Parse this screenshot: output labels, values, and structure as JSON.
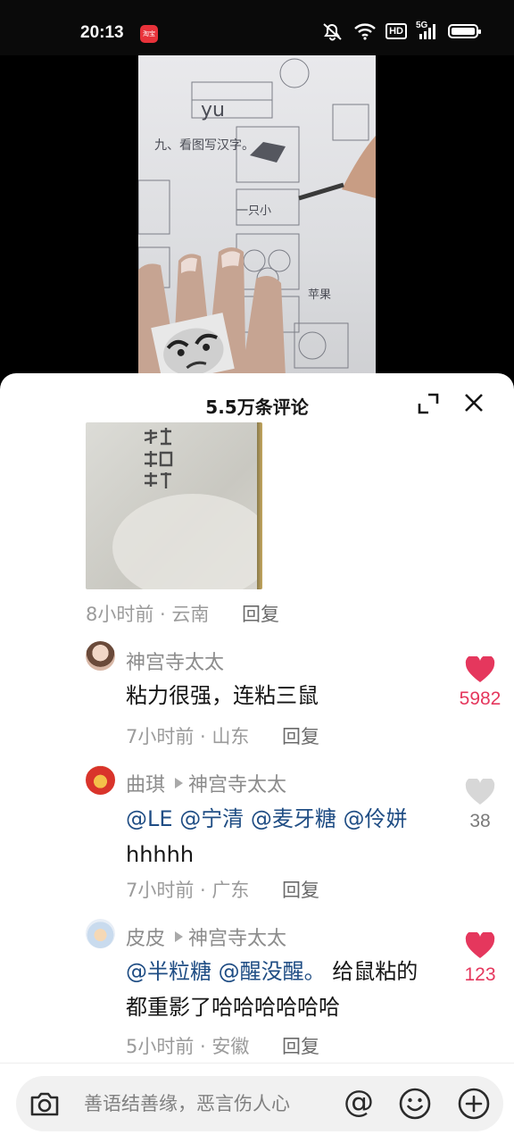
{
  "status_bar": {
    "time": "20:13",
    "app_badge": "淘宝",
    "icons": [
      "mute-icon",
      "wifi-icon",
      "hd-icon",
      "signal-5g-icon",
      "battery-icon"
    ],
    "hd_label": "HD",
    "network_label": "5G"
  },
  "video": {
    "description_icon": "video-frame"
  },
  "comments_sheet": {
    "title": "5.5万条评论",
    "expand_icon": "expand-icon",
    "close_icon": "close-icon"
  },
  "top_comment": {
    "time_location": "8小时前 · 云南",
    "reply_label": "回复"
  },
  "replies": [
    {
      "username": "神宫寺太太",
      "reply_to": "",
      "text_plain": "粘力很强，连粘三鼠",
      "time_location": "7小时前 · 山东",
      "reply_label": "回复",
      "likes": "5982",
      "liked": true
    },
    {
      "username": "曲琪",
      "reply_to": "神宫寺太太",
      "mentions": [
        "@LE",
        "@宁清",
        "@麦牙糖",
        "@伶姘"
      ],
      "text_tail": "hhhhh",
      "time_location": "7小时前 · 广东",
      "reply_label": "回复",
      "likes": "38",
      "liked": false
    },
    {
      "username": "皮皮",
      "reply_to": "神宫寺太太",
      "mentions": [
        "@半粒糖",
        "@醒没醒。"
      ],
      "text_tail_line1": "给鼠粘的",
      "text_tail_line2": "都重影了哈哈哈哈哈哈",
      "time_location": "5小时前 · 安徽",
      "reply_label": "回复",
      "likes": "123",
      "liked": true
    }
  ],
  "input_bar": {
    "placeholder": "善语结善缘，恶言伤人心",
    "at_label": "@"
  },
  "colors": {
    "like_red": "#e5375d",
    "mention_blue": "#1f4d84",
    "meta_gray": "#9b9b9b"
  }
}
